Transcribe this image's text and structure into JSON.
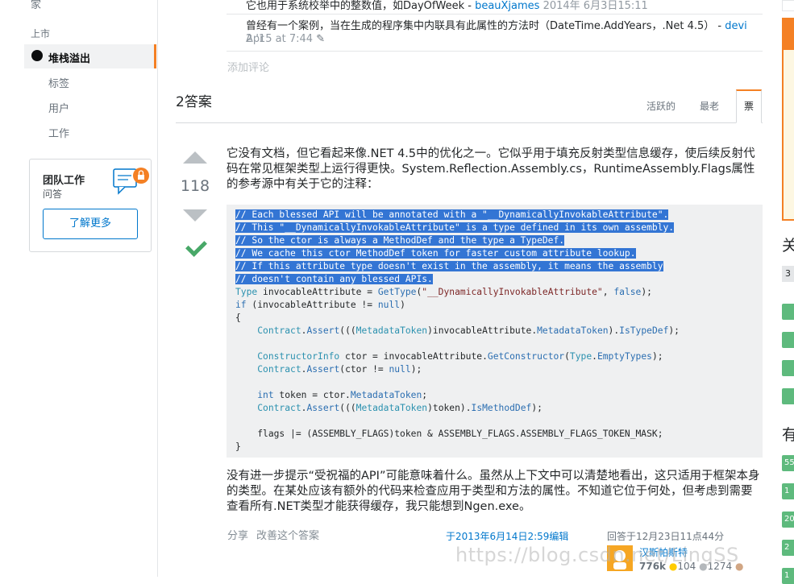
{
  "sidebar": {
    "home_label": "家",
    "public_heading": "上市",
    "stackoverflow_label": "堆栈溢出",
    "items": [
      {
        "label": "标签"
      },
      {
        "label": "用户"
      },
      {
        "label": "工作"
      }
    ],
    "teams": {
      "title": "团队工作",
      "subtitle": "问答",
      "button_label": "了解更多"
    }
  },
  "comments": [
    {
      "text": "它也用于系统校举中的整数值，如DayOfWeek -",
      "user": "beauXjames",
      "time": "2014年 6月3日15:11"
    },
    {
      "text": "曾经有一个案例，当在生成的程序集中内联具有此属性的方法时（DateTime.AddYears，.Net 4.5） -",
      "user": "devi",
      "time_a": "Apr",
      "time_b": "2 '15 at 7:44"
    }
  ],
  "add_comment": "添加评论",
  "answers_header": {
    "count_label": "2答案",
    "tabs": [
      "活跃的",
      "最老",
      "票"
    ],
    "selected_tab": "票"
  },
  "answer": {
    "score": "118",
    "accepted": true,
    "intro": "它没有文档，但它看起来像.NET 4.5中的优化之一。它似乎用于填充反射类型信息缓存，使后续反射代码在常见框架类型上运行得更快。System.Reflection.Assembly.cs，RuntimeAssembly.Flags属性的参考源中有关于它的注释：",
    "code": {
      "comments": [
        "// Each blessed API will be annotated with a \"__DynamicallyInvokableAttribute\".",
        "// This \"__DynamicallyInvokableAttribute\" is a type defined in its own assembly.",
        "// So the ctor is always a MethodDef and the type a TypeDef.",
        "// We cache this ctor MethodDef token for faster custom attribute lookup.",
        "// If this attribute type doesn't exist in the assembly, it means the assembly",
        "// doesn't contain any blessed APIs."
      ],
      "line_getType": {
        "t": "Type",
        "v": " invocableAttribute = ",
        "m": "GetType",
        "p1": "(",
        "s": "\"__DynamicallyInvokableAttribute\"",
        "p2": ", ",
        "k": "false",
        "p3": ");"
      },
      "line_if": {
        "k": "if",
        "rest": " (invocableAttribute != ",
        "n": "null",
        "end": ")"
      },
      "open_brace": "{",
      "close_brace": "}",
      "line_assert1": {
        "c": "Contract",
        "d": ".",
        "a": "Assert",
        "p": "(((",
        "t": "MetadataToken",
        "x": ")invocableAttribute.",
        "m": "MetadataToken",
        "y": ").",
        "z": "IsTypeDef",
        "e": ");"
      },
      "line_ctor": {
        "t": "ConstructorInfo",
        "v": " ctor = invocableAttribute.",
        "m": "GetConstructor",
        "p": "(",
        "t2": "Type",
        "d": ".",
        "f": "EmptyTypes",
        "e": ");"
      },
      "line_assert2": {
        "c": "Contract",
        "d": ".",
        "a": "Assert",
        "p": "(ctor != ",
        "n": "null",
        "e": ");"
      },
      "line_token": {
        "k": "int",
        "v": " token = ctor.",
        "m": "MetadataToken",
        "e": ";"
      },
      "line_assert3": {
        "c": "Contract",
        "d": ".",
        "a": "Assert",
        "p": "(((",
        "t": "MetadataToken",
        "x": ")token).",
        "m": "IsMethodDef",
        "e": ");"
      },
      "line_flags": "flags |= (ASSEMBLY_FLAGS)token & ASSEMBLY_FLAGS.ASSEMBLY_FLAGS_TOKEN_MASK;"
    },
    "outro": "没有进一步提示“受祝福的API”可能意味着什么。虽然从上下文中可以清楚地看出，这只适用于框架本身的类型。在某处应该有额外的代码来检查应用于类型和方法的属性。不知道它位于何处，但考虑到需要查看所有.NET类型才能获得缓存，我只能想到Ngen.exe。",
    "share_label": "分享",
    "improve_label": "改善这个答案",
    "edited_label": "于2013年6月14日2:59编辑",
    "answered_label": "回答于12月23日11点44分",
    "user": {
      "name": "汉斯帕斯特",
      "rep": "776k",
      "gold": "104",
      "silver": "1274"
    }
  },
  "right_panel": {
    "related_heading_partial": "关",
    "linked_heading_partial": "有",
    "tags": [
      "3"
    ],
    "linked_counts": [
      "55",
      "1",
      "20",
      "2",
      "1"
    ]
  },
  "watermark": "https://blog.csdn.net/LingSS"
}
